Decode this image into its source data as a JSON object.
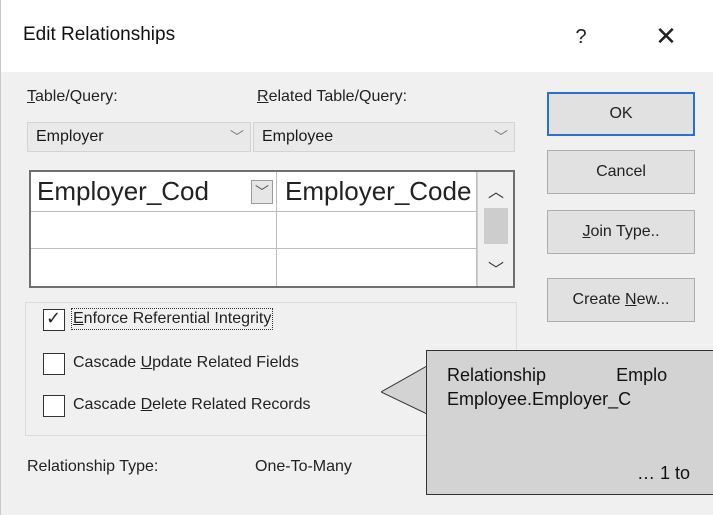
{
  "dialog": {
    "title": "Edit Relationships",
    "help_label": "?",
    "close_label": "✕"
  },
  "left": {
    "table_label": {
      "accel": "T",
      "rest": "able/Query:"
    },
    "table_value": "Employer",
    "related_label": {
      "accel": "R",
      "rest": "elated Table/Query:"
    },
    "related_value": "Employee"
  },
  "grid": {
    "rows": [
      {
        "left": "Employer_Cod",
        "right": "Employer_Code"
      },
      {
        "left": "",
        "right": ""
      },
      {
        "left": "",
        "right": ""
      }
    ]
  },
  "buttons": {
    "ok": "OK",
    "cancel": "Cancel",
    "join_type": {
      "accel": "J",
      "rest": "oin Type.."
    },
    "create_new": {
      "pre": "Create ",
      "accel": "N",
      "rest": "ew..."
    }
  },
  "options": {
    "enforce": {
      "checked": true,
      "accel": "E",
      "rest": "nforce Referential Integrity"
    },
    "cascade_update": {
      "checked": false,
      "pre": "Cascade ",
      "accel": "U",
      "rest": "pdate Related Fields"
    },
    "cascade_delete": {
      "checked": false,
      "pre": "Cascade ",
      "accel": "D",
      "rest": "elete Related Records"
    }
  },
  "relationship": {
    "label": "Relationship Type:",
    "value": "One-To-Many"
  },
  "tooltip": {
    "line1_a": "Relationship",
    "line1_b": "Emplo",
    "line2": "Employee.Employer_C",
    "line3": "… 1 to"
  },
  "icons": {
    "combo_arrow": "chevron-down-icon",
    "scroll_up": "chevron-up-icon",
    "scroll_down": "chevron-down-icon",
    "check": "check-icon"
  },
  "colors": {
    "dialog_bg": "#f0f0f0",
    "default_button_border": "#2d6fcf",
    "tooltip_bg": "#d3d3d3"
  }
}
